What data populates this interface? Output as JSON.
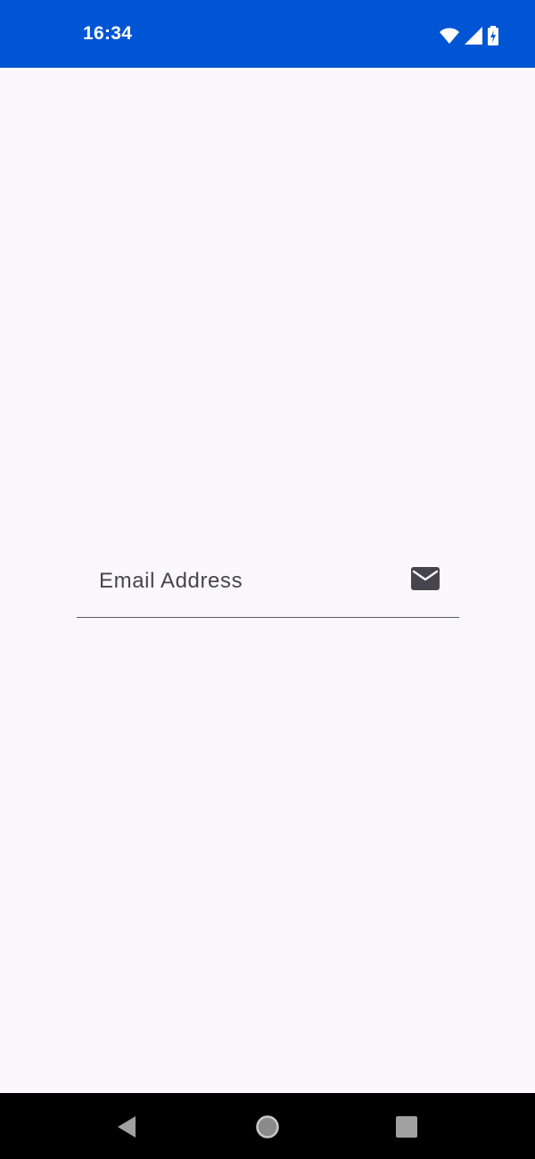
{
  "status_bar": {
    "time": "16:34",
    "background_color": "#0055d4",
    "icons": [
      "wifi-icon",
      "cellular-signal-icon",
      "battery-charging-icon"
    ]
  },
  "form": {
    "email_field": {
      "placeholder": "Email Address",
      "value": "",
      "trailing_icon": "email-icon"
    }
  },
  "navigation_bar": {
    "buttons": [
      "back-button",
      "home-button",
      "recents-button"
    ]
  }
}
